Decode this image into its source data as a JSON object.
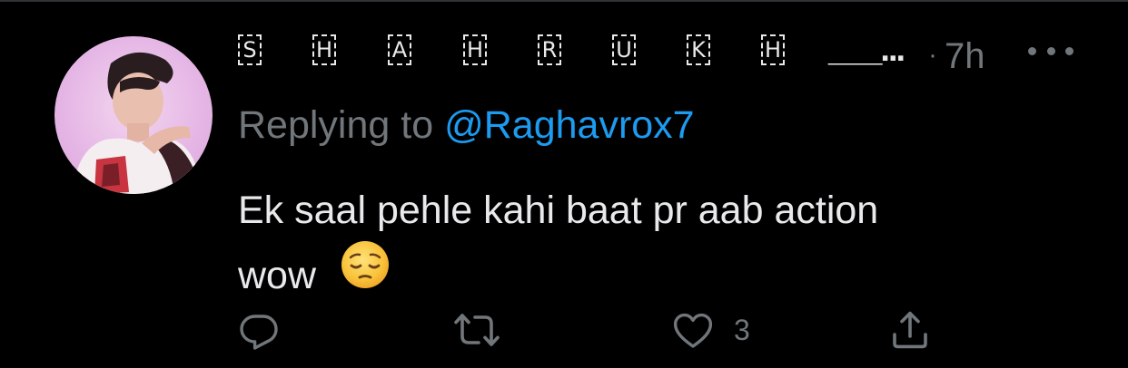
{
  "tweet": {
    "name_letters": [
      "S",
      "H",
      "A",
      "H",
      "R",
      "U",
      "K",
      "H"
    ],
    "name_suffix": "___...",
    "separator": "·",
    "time": "7h",
    "replying_prefix": "Replying to ",
    "replying_handle": "@Raghavrox7",
    "text_line1": "Ek saal pehle kahi baat pr aab action",
    "text_line2": "wow",
    "emoji": "pensive-face-emoji"
  },
  "actions": {
    "reply_icon": "reply-icon",
    "retweet_icon": "retweet-icon",
    "like_icon": "heart-icon",
    "like_count": "3",
    "share_icon": "share-icon"
  },
  "colors": {
    "background": "#000000",
    "text": "#e7e9ea",
    "muted": "#71767b",
    "link": "#1d9bf0"
  }
}
